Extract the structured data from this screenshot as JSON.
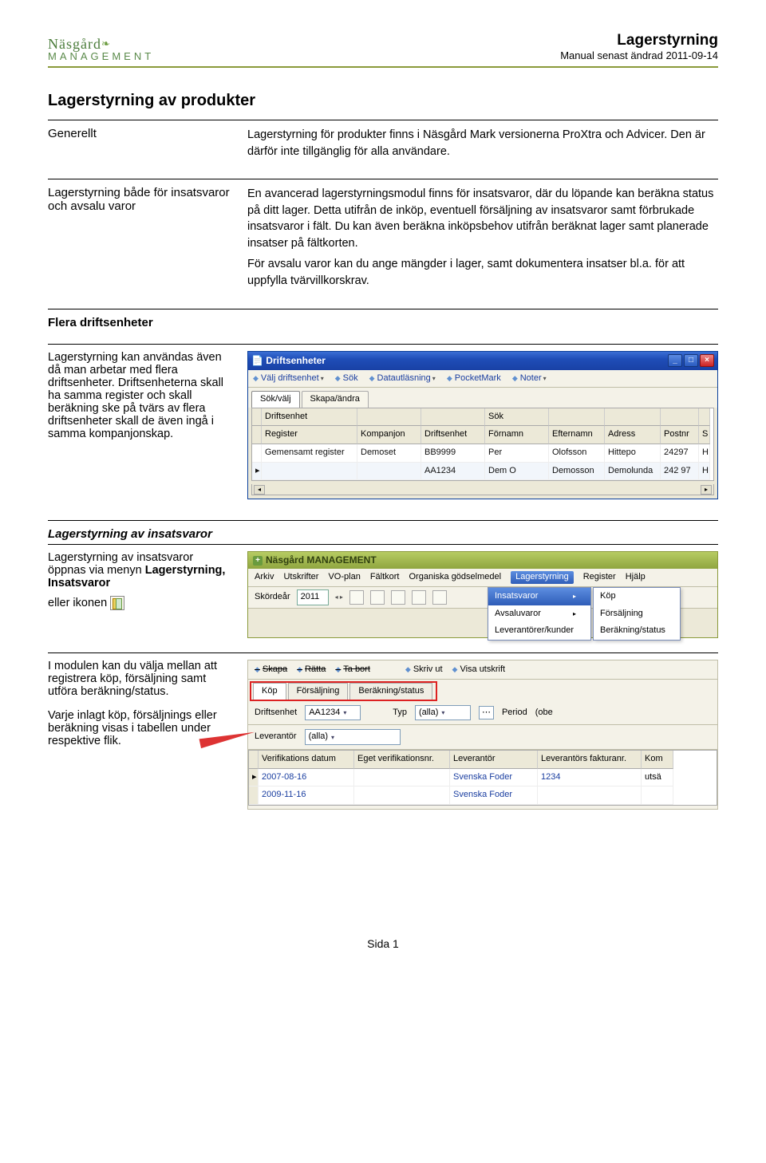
{
  "header": {
    "logo_top": "Näsgård",
    "logo_bottom": "MANAGEMENT",
    "title": "Lagerstyrning",
    "subtitle": "Manual senast ändrad 2011-09-14"
  },
  "main_title": "Lagerstyrning av produkter",
  "sec1": {
    "left": "Generellt",
    "right": "Lagerstyrning för produkter finns i Näsgård Mark versionerna ProXtra och Advicer. Den är därför inte tillgänglig för alla användare."
  },
  "sec2": {
    "left": "Lagerstyrning både för insatsvaror och avsalu varor",
    "p1": "En avancerad lagerstyrningsmodul finns för insatsvaror, där du löpande kan beräkna status på ditt lager. Detta utifrån de inköp, eventuell försäljning av insatsvaror samt förbrukade insatsvaror i fält. Du kan även beräkna inköpsbehov utifrån beräknat lager samt planerade insatser på fältkorten.",
    "p2": "För avsalu varor kan du ange mängder i lager, samt dokumentera insatser bl.a. för att uppfylla tvärvillkorskrav."
  },
  "sec3_left_heading": "Flera driftsenheter",
  "sec3_left_body": "Lagerstyrning kan användas även då man arbetar med flera driftsenheter. Driftsenheterna skall ha samma register och skall beräkning ske på tvärs av flera driftsenheter skall de även ingå i samma kompanjonskap.",
  "win1": {
    "title": "Driftsenheter",
    "toolbar": [
      "Välj driftsenhet",
      "Sök",
      "Datautläsning",
      "PocketMark",
      "Noter"
    ],
    "tabs": [
      "Sök/välj",
      "Skapa/ändra"
    ],
    "columns": [
      "Driftsenhet",
      "",
      "",
      "Sök",
      "",
      "",
      "",
      ""
    ],
    "columns2": [
      "Register",
      "Kompanjon",
      "Driftsenhet",
      "Förnamn",
      "Efternamn",
      "Adress",
      "Postnr",
      "S"
    ],
    "rows": [
      [
        "Gemensamt register",
        "Demoset",
        "BB9999",
        "Per",
        "Olofsson",
        "Hittepo",
        "24297",
        "H"
      ],
      [
        "",
        "",
        "AA1234",
        "Dem O",
        "Demosson",
        "Demolunda",
        "242 97",
        "H"
      ]
    ]
  },
  "sec4_heading": "Lagerstyrning av insatsvaror",
  "sec4_p1a": "Lagerstyrning av insatsvaror öppnas via menyn ",
  "sec4_p1b": "Lagerstyrning, Insatsvaror",
  "sec4_p2": "eller ikonen",
  "win2": {
    "title": "Näsgård MANAGEMENT",
    "menubar": [
      "Arkiv",
      "Utskrifter",
      "VO-plan",
      "Fältkort",
      "Organiska gödselmedel",
      "Lagerstyrning",
      "Register",
      "Hjälp"
    ],
    "year_label": "Skördeår",
    "year": "2011",
    "dd1": [
      "Insatsvaror",
      "Avsaluvaror",
      "Leverantörer/kunder"
    ],
    "dd2": [
      "Köp",
      "Försäljning",
      "Beräkning/status"
    ]
  },
  "sec5_p1": "I modulen kan du välja mellan att registrera köp, försäljning samt utföra beräkning/status.",
  "sec5_p2": "Varje inlagt köp, försäljnings eller beräkning visas i tabellen under respektive flik.",
  "win3": {
    "toolbar": [
      "Skapa",
      "Rätta",
      "Ta bort",
      "Skriv ut",
      "Visa utskrift"
    ],
    "tabs": [
      "Köp",
      "Försäljning",
      "Beräkning/status"
    ],
    "drift_label": "Driftsenhet",
    "drift_value": "AA1234",
    "typ_label": "Typ",
    "typ_value": "(alla)",
    "period_label": "Period",
    "period_value": "(obe",
    "lev_label": "Leverantör",
    "lev_value": "(alla)",
    "columns": [
      "Verifikations datum",
      "Eget verifikationsnr.",
      "Leverantör",
      "Leverantörs fakturanr.",
      "Kom"
    ],
    "rows": [
      [
        "2007-08-16",
        "",
        "Svenska Foder",
        "1234",
        "utsä"
      ],
      [
        "2009-11-16",
        "",
        "Svenska Foder",
        "",
        ""
      ]
    ]
  },
  "footer": "Sida 1"
}
